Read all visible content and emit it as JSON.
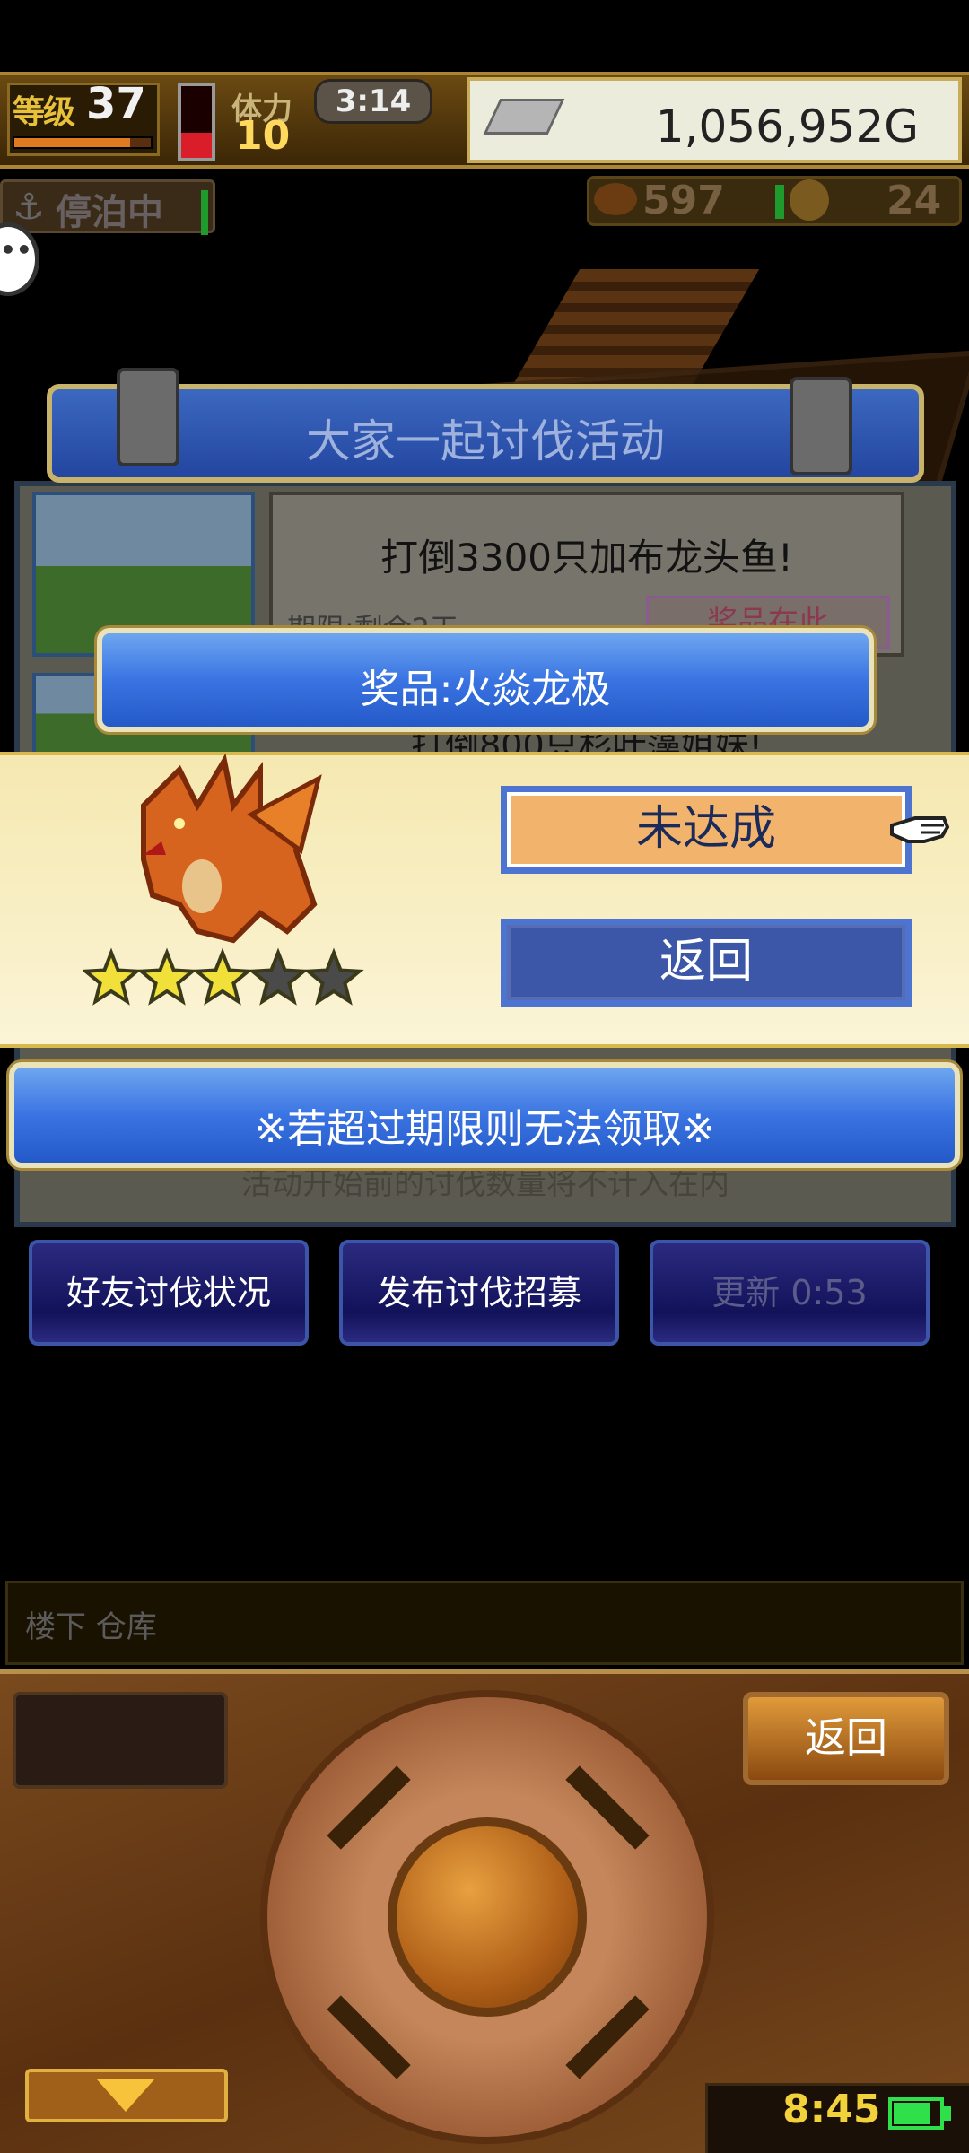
{
  "hud": {
    "level_label": "等级",
    "level": "37",
    "level_progress": 0.85,
    "hp_fraction": 0.35,
    "stamina_label": "体力",
    "stamina": "10",
    "timer": "3:14",
    "gold": "1,056,952G",
    "moor_label": "停泊中",
    "resource1": "597",
    "resource2": "24"
  },
  "event": {
    "title": "大家一起讨伐活动",
    "goal1": "打倒3300只加布龙头鱼!",
    "deadline": "期限:剩余2天",
    "reward_button": "奖品在此",
    "goal2": "打倒800只杉叶藻姐妹!",
    "note": "活动开始前的讨伐数量将不计入在内"
  },
  "popup": {
    "title": "奖品:火焱龙极",
    "stars_filled": 3,
    "stars_total": 5,
    "not_achieved": "未达成",
    "back": "返回",
    "warning": "※若超过期限则无法领取※"
  },
  "nav": {
    "friends": "好友讨伐状况",
    "recruit": "发布讨伐招募",
    "refresh": "更新 0:53"
  },
  "location": "楼下 仓库",
  "controller": {
    "back": "返回",
    "clock": "8:45",
    "battery": 0.8
  },
  "colors": {
    "accent_blue": "#3a74e2",
    "star": "#f2e03a",
    "gold": "#ffd95e"
  }
}
